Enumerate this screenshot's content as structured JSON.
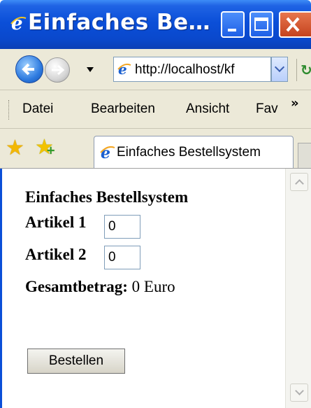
{
  "window": {
    "title": "Einfaches Be…"
  },
  "address": {
    "url": "http://localhost/kf"
  },
  "menu": {
    "items": [
      "Datei",
      "Bearbeiten",
      "Ansicht",
      "Fav"
    ],
    "overflow": "»"
  },
  "tabs": [
    {
      "label": "Einfaches Bestellsystem"
    }
  ],
  "page": {
    "heading": "Einfaches Bestellsystem",
    "item1_label": "Artikel 1",
    "item1_value": "0",
    "item2_label": "Artikel 2",
    "item2_value": "0",
    "total_label": "Gesamtbetrag:",
    "total_value": "0 Euro",
    "order_button": "Bestellen"
  },
  "colors": {
    "titlebar": "#0b4fd8",
    "chrome": "#ece9d8",
    "close": "#c5431e"
  },
  "icons": [
    "ie-icon",
    "back-icon",
    "forward-icon",
    "refresh-icon",
    "favorites-star-icon",
    "add-favorites-icon"
  ]
}
